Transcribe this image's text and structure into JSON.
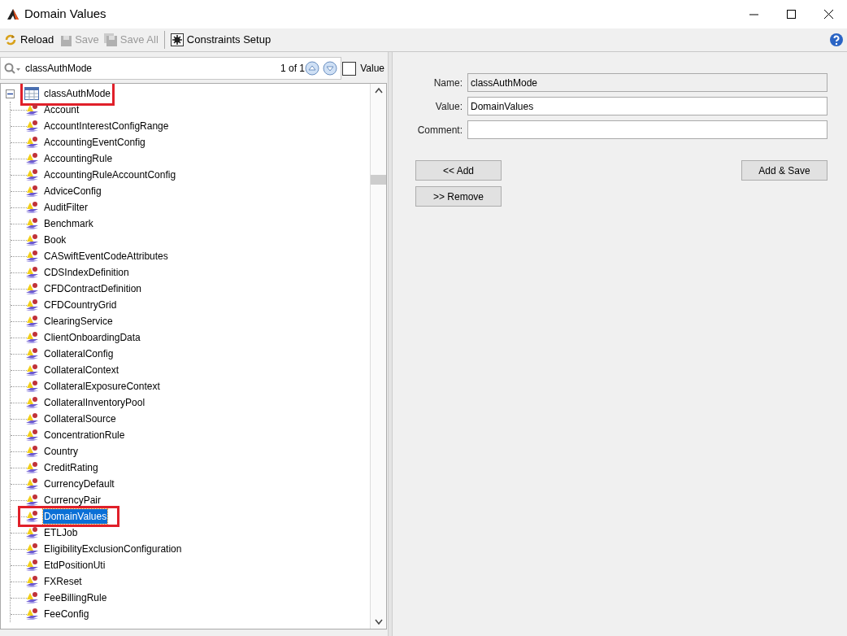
{
  "window": {
    "title": "Domain Values"
  },
  "toolbar": [
    {
      "label": "Reload",
      "kind": "reload",
      "disabled": false
    },
    {
      "label": "Save",
      "kind": "save",
      "disabled": true
    },
    {
      "label": "Save All",
      "kind": "saveall",
      "disabled": true
    },
    {
      "label": "Constraints Setup",
      "kind": "constraints",
      "disabled": false
    }
  ],
  "search": {
    "value": "classAuthMode",
    "count": "1 of 1",
    "value_checkbox": {
      "label": "Value",
      "checked": false
    }
  },
  "tree": {
    "label": "classAuthMode",
    "expanded": true,
    "marked": true,
    "children": [
      {
        "label": "Account",
        "selected": false,
        "marked": false
      },
      {
        "label": "AccountInterestConfigRange",
        "selected": false,
        "marked": false
      },
      {
        "label": "AccountingEventConfig",
        "selected": false,
        "marked": false
      },
      {
        "label": "AccountingRule",
        "selected": false,
        "marked": false
      },
      {
        "label": "AccountingRuleAccountConfig",
        "selected": false,
        "marked": false
      },
      {
        "label": "AdviceConfig",
        "selected": false,
        "marked": false
      },
      {
        "label": "AuditFilter",
        "selected": false,
        "marked": false
      },
      {
        "label": "Benchmark",
        "selected": false,
        "marked": false
      },
      {
        "label": "Book",
        "selected": false,
        "marked": false
      },
      {
        "label": "CASwiftEventCodeAttributes",
        "selected": false,
        "marked": false
      },
      {
        "label": "CDSIndexDefinition",
        "selected": false,
        "marked": false
      },
      {
        "label": "CFDContractDefinition",
        "selected": false,
        "marked": false
      },
      {
        "label": "CFDCountryGrid",
        "selected": false,
        "marked": false
      },
      {
        "label": "ClearingService",
        "selected": false,
        "marked": false
      },
      {
        "label": "ClientOnboardingData",
        "selected": false,
        "marked": false
      },
      {
        "label": "CollateralConfig",
        "selected": false,
        "marked": false
      },
      {
        "label": "CollateralContext",
        "selected": false,
        "marked": false
      },
      {
        "label": "CollateralExposureContext",
        "selected": false,
        "marked": false
      },
      {
        "label": "CollateralInventoryPool",
        "selected": false,
        "marked": false
      },
      {
        "label": "CollateralSource",
        "selected": false,
        "marked": false
      },
      {
        "label": "ConcentrationRule",
        "selected": false,
        "marked": false
      },
      {
        "label": "Country",
        "selected": false,
        "marked": false
      },
      {
        "label": "CreditRating",
        "selected": false,
        "marked": false
      },
      {
        "label": "CurrencyDefault",
        "selected": false,
        "marked": false
      },
      {
        "label": "CurrencyPair",
        "selected": false,
        "marked": false
      },
      {
        "label": "DomainValues",
        "selected": true,
        "marked": true
      },
      {
        "label": "ETLJob",
        "selected": false,
        "marked": false
      },
      {
        "label": "EligibilityExclusionConfiguration",
        "selected": false,
        "marked": false
      },
      {
        "label": "EtdPositionUti",
        "selected": false,
        "marked": false
      },
      {
        "label": "FXReset",
        "selected": false,
        "marked": false
      },
      {
        "label": "FeeBillingRule",
        "selected": false,
        "marked": false
      },
      {
        "label": "FeeConfig",
        "selected": false,
        "marked": false
      }
    ]
  },
  "form": {
    "fields": [
      {
        "label": "Name:",
        "value": "classAuthMode",
        "disabled": true
      },
      {
        "label": "Value:",
        "value": "DomainValues",
        "disabled": false
      },
      {
        "label": "Comment:",
        "disabled": false
      }
    ],
    "buttons": [
      {
        "label": "<< Add",
        "kind": "left"
      },
      {
        "label": "Add & Save",
        "kind": "right"
      },
      {
        "label": ">> Remove",
        "kind": "left"
      }
    ]
  }
}
